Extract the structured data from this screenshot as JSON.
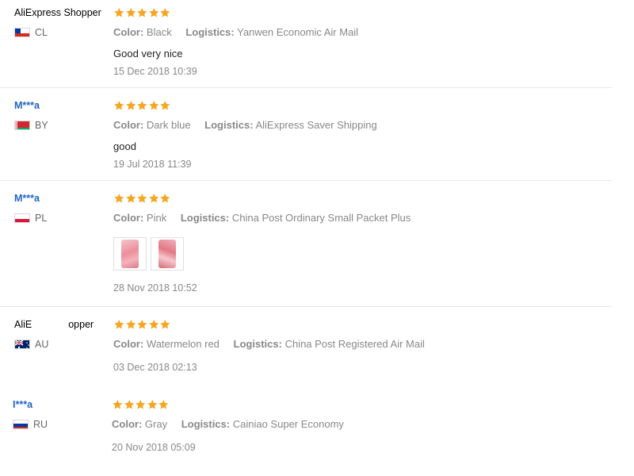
{
  "labels": {
    "color": "Color:",
    "logistics": "Logistics:"
  },
  "star_color": "#f5a623",
  "reviews": [
    {
      "user": "AliExpress Shopper",
      "country": "CL",
      "rating": 5,
      "color": "Black",
      "logistics": "Yanwen Economic Air Mail",
      "comment": "Good very nice",
      "date": "15 Dec 2018 10:39"
    },
    {
      "user": "M***a",
      "country": "BY",
      "rating": 5,
      "color": "Dark blue",
      "logistics": "AliExpress Saver Shipping",
      "comment": "good",
      "date": "19 Jul 2018 11:39"
    },
    {
      "user": "M***a",
      "country": "PL",
      "rating": 5,
      "color": "Pink",
      "logistics": "China Post Ordinary Small Packet Plus",
      "photos": [
        "pink-item-photo-1",
        "pink-item-photo-2"
      ],
      "date": "28 Nov 2018 10:52"
    },
    {
      "user_start": "AliE",
      "user_end": "opper",
      "country": "AU",
      "rating": 5,
      "color": "Watermelon red",
      "logistics": "China Post Registered Air Mail",
      "date": "03 Dec 2018 02:13"
    },
    {
      "user": "I***a",
      "country": "RU",
      "rating": 5,
      "color": "Gray",
      "logistics": "Cainiao Super Economy",
      "date": "20 Nov 2018 05:09"
    }
  ]
}
